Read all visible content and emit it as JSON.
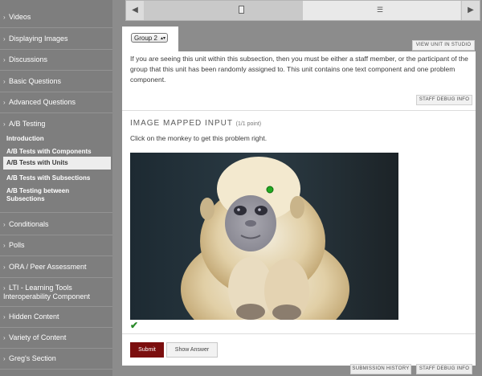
{
  "sidebar": {
    "items": [
      {
        "label": "Videos"
      },
      {
        "label": "Displaying Images"
      },
      {
        "label": "Discussions"
      },
      {
        "label": "Basic Questions"
      },
      {
        "label": "Advanced Questions"
      },
      {
        "label": "A/B Testing"
      },
      {
        "label": "Conditionals"
      },
      {
        "label": "Polls"
      },
      {
        "label": "ORA / Peer Assessment"
      },
      {
        "label": "LTI - Learning Tools Interoperability Component"
      },
      {
        "label": "Hidden Content"
      },
      {
        "label": "Variety of Content"
      },
      {
        "label": "Greg's Section"
      }
    ],
    "subitems": [
      {
        "label": "Introduction"
      },
      {
        "label": "A/B Tests with Components"
      },
      {
        "label": "A/B Tests with Units"
      },
      {
        "label": "A/B Tests with Subsections"
      },
      {
        "label": "A/B Testing between Subsections"
      }
    ]
  },
  "unit": {
    "group_select": "Group 2",
    "view_in_studio": "VIEW UNIT IN STUDIO",
    "intro": "If you are seeing this unit within this subsection, then you must be either a staff member, or the participant of the group that this unit has been randomly assigned to.  This unit contains one text component and one problem component.",
    "staff_debug": "STAFF DEBUG INFO"
  },
  "problem": {
    "title": "IMAGE MAPPED INPUT",
    "points": "(1/1 point)",
    "prompt": "Click on the monkey to get this problem right.",
    "submit": "Submit",
    "show_answer": "Show Answer",
    "submission_history": "SUBMISSION HISTORY",
    "staff_debug": "STAFF DEBUG INFO"
  },
  "colors": {
    "submit": "#7b0e0e",
    "correct": "#2a8a2a",
    "marker": "#22aa22"
  }
}
